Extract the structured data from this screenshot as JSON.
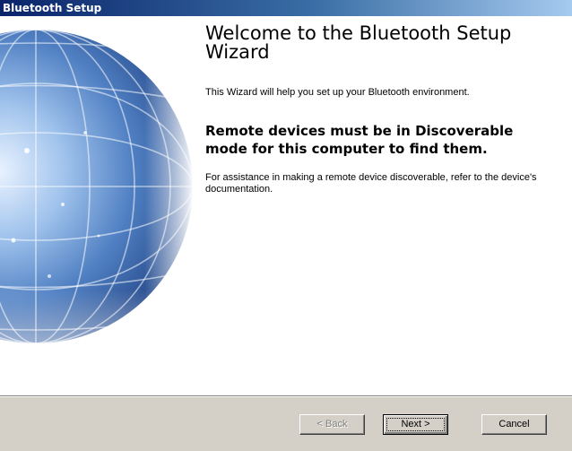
{
  "window": {
    "title": "Bluetooth Setup"
  },
  "wizard": {
    "heading": "Welcome to the Bluetooth Setup Wizard",
    "intro": "This Wizard will help you set up your Bluetooth environment.",
    "warning": "Remote devices must be in Discoverable mode for this computer to find them.",
    "assist": "For assistance in making a remote device discoverable, refer to the device's documentation.",
    "art_icon": "globe-icon"
  },
  "buttons": {
    "back_label": "< Back",
    "next_label": "Next >",
    "cancel_label": "Cancel"
  },
  "colors": {
    "titlebar_start": "#0a246a",
    "titlebar_end": "#a6caf0",
    "dialog_face": "#d4d0c8"
  }
}
